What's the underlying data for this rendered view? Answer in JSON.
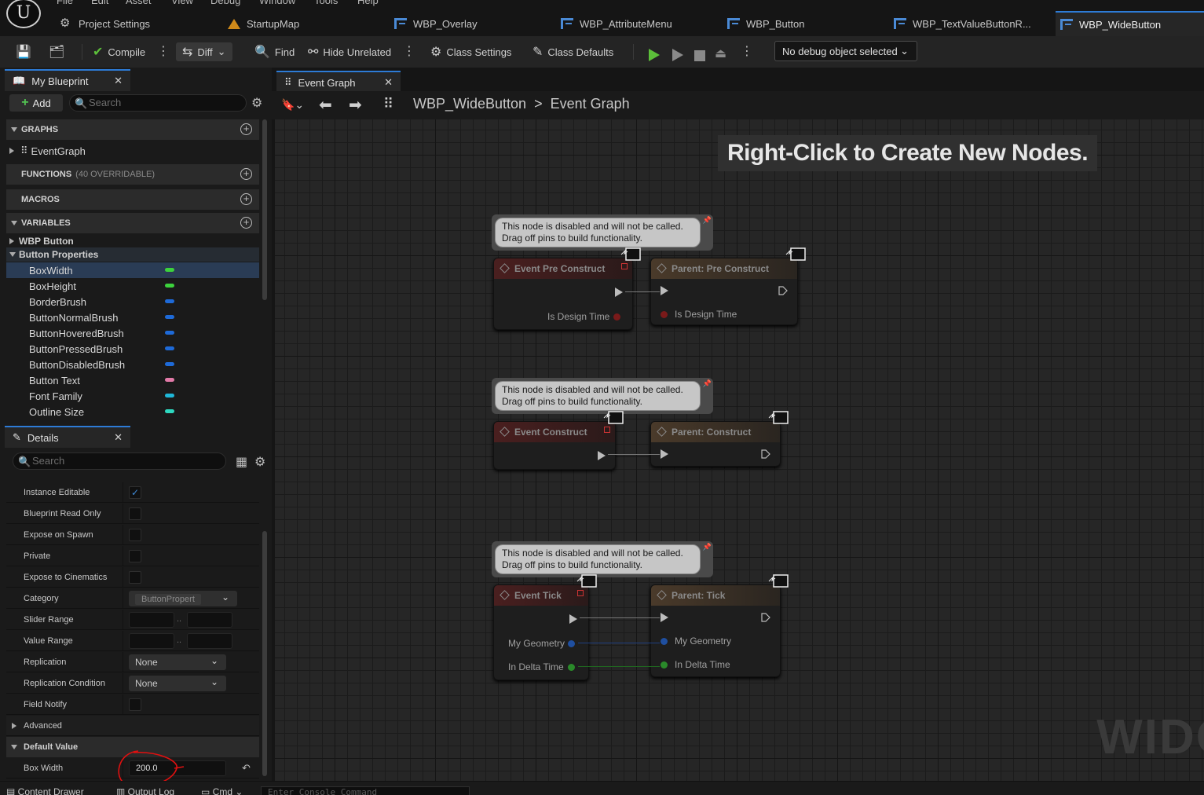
{
  "logo": "U",
  "menu": [
    "File",
    "Edit",
    "Asset",
    "View",
    "Debug",
    "Window",
    "Tools",
    "Help"
  ],
  "tabs": [
    {
      "label": "Project Settings",
      "icon": "gear-icon"
    },
    {
      "label": "StartupMap",
      "icon": "map-icon"
    },
    {
      "label": "WBP_Overlay",
      "icon": "widget-blueprint-icon"
    },
    {
      "label": "WBP_AttributeMenu",
      "icon": "widget-blueprint-icon"
    },
    {
      "label": "WBP_Button",
      "icon": "widget-blueprint-icon"
    },
    {
      "label": "WBP_TextValueButtonR...",
      "icon": "widget-blueprint-icon"
    },
    {
      "label": "WBP_WideButton",
      "icon": "widget-blueprint-icon",
      "active": true
    }
  ],
  "toolbar": {
    "compile": "Compile",
    "diff": "Diff",
    "find": "Find",
    "hide_unrelated": "Hide Unrelated",
    "class_settings": "Class Settings",
    "class_defaults": "Class Defaults",
    "debug_object": "No debug object selected"
  },
  "my_blueprint": {
    "tab": "My Blueprint",
    "add": "Add",
    "search_placeholder": "Search",
    "graphs_header": "GRAPHS",
    "event_graph": "EventGraph",
    "functions_header": "FUNCTIONS",
    "functions_sub": "(40 OVERRIDABLE)",
    "macros_header": "MACROS",
    "variables_header": "VARIABLES",
    "cat_wbp_button": "WBP Button",
    "cat_button_properties": "Button Properties",
    "variables": [
      {
        "name": "BoxWidth",
        "color": "#3cd23c",
        "selected": true
      },
      {
        "name": "BoxHeight",
        "color": "#3cd23c"
      },
      {
        "name": "BorderBrush",
        "color": "#1e6ad8"
      },
      {
        "name": "ButtonNormalBrush",
        "color": "#1e6ad8"
      },
      {
        "name": "ButtonHoveredBrush",
        "color": "#1e6ad8"
      },
      {
        "name": "ButtonPressedBrush",
        "color": "#1e6ad8"
      },
      {
        "name": "ButtonDisabledBrush",
        "color": "#1e6ad8"
      },
      {
        "name": "Button Text",
        "color": "#e27aa8"
      },
      {
        "name": "Font Family",
        "color": "#1fb7d8"
      },
      {
        "name": "Outline Size",
        "color": "#2ed8c0"
      }
    ]
  },
  "details": {
    "tab": "Details",
    "search_placeholder": "Search",
    "instance_editable": "Instance Editable",
    "blueprint_read_only": "Blueprint Read Only",
    "expose_on_spawn": "Expose on Spawn",
    "private": "Private",
    "expose_to_cinematics": "Expose to Cinematics",
    "category": "Category",
    "category_value": "ButtonPropert",
    "slider_range": "Slider Range",
    "value_range": "Value Range",
    "replication": "Replication",
    "replication_value": "None",
    "replication_condition": "Replication Condition",
    "replication_condition_value": "None",
    "field_notify": "Field Notify",
    "advanced": "Advanced",
    "default_value": "Default Value",
    "box_width": "Box Width",
    "box_width_value": "200.0",
    "range_sep": ".."
  },
  "graph": {
    "tab": "Event Graph",
    "breadcrumb_root": "WBP_WideButton",
    "breadcrumb_sep": ">",
    "breadcrumb_leaf": "Event Graph",
    "hint": "Right-Click to Create New Nodes.",
    "watermark": "WIDG",
    "comment_line1": "This node is disabled and will not be called.",
    "comment_line2": "Drag off pins to build functionality.",
    "nodes": {
      "pre_construct": "Event Pre Construct",
      "parent_pre_construct": "Parent: Pre Construct",
      "is_design_time": "Is Design Time",
      "is_design_time_2": "Is Design Time",
      "construct": "Event Construct",
      "parent_construct": "Parent: Construct",
      "tick": "Event Tick",
      "parent_tick": "Parent: Tick",
      "my_geometry": "My Geometry",
      "in_delta_time": "In Delta Time",
      "my_geometry_2": "My Geometry",
      "in_delta_time_2": "In Delta Time"
    }
  },
  "bottom": {
    "content_drawer": "Content Drawer",
    "output_log": "Output Log",
    "cmd": "Cmd",
    "console_placeholder": "Enter Console Command"
  }
}
